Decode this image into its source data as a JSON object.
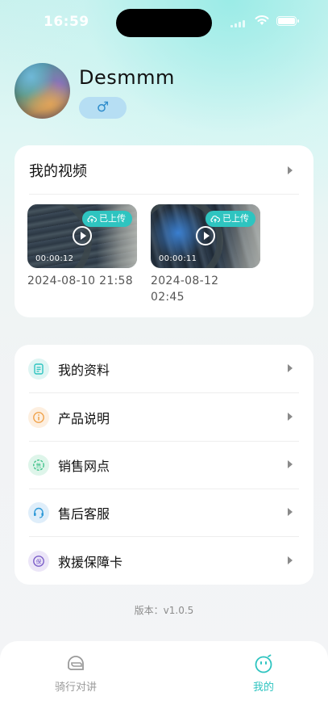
{
  "status_bar": {
    "time": "16:59"
  },
  "profile": {
    "username": "Desmmm",
    "gender_symbol": "♂"
  },
  "videos": {
    "title": "我的视频",
    "items": [
      {
        "badge": "已上传",
        "duration": "00:00:12",
        "date": "2024-08-10 21:58"
      },
      {
        "badge": "已上传",
        "duration": "00:00:11",
        "date": "2024-08-12 02:45"
      }
    ]
  },
  "menu": {
    "items": [
      {
        "label": "我的资料",
        "icon": "profile-doc-icon",
        "color": "#2ec4c0"
      },
      {
        "label": "产品说明",
        "icon": "info-icon",
        "color": "#f0a24a"
      },
      {
        "label": "销售网点",
        "icon": "sales-outlet-icon",
        "color": "#3fc28a"
      },
      {
        "label": "售后客服",
        "icon": "headset-icon",
        "color": "#2f9ad8"
      },
      {
        "label": "救援保障卡",
        "icon": "insurance-card-icon",
        "color": "#7a5cc8"
      }
    ]
  },
  "version": "版本：v1.0.5",
  "tabbar": {
    "tabs": [
      {
        "label": "骑行对讲",
        "icon": "helmet-icon",
        "active": false
      },
      {
        "label": "我的",
        "icon": "smiley-icon",
        "active": true
      }
    ],
    "accent": "#2ec4c0"
  }
}
